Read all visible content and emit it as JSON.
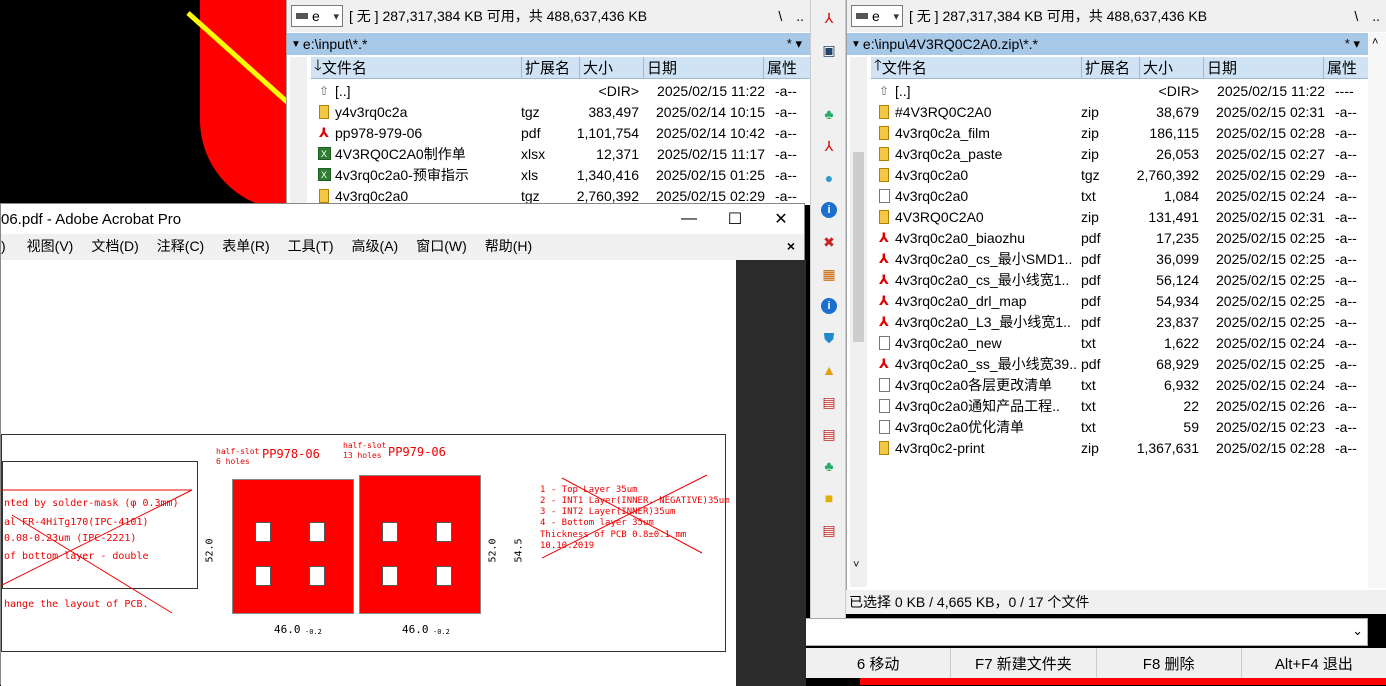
{
  "left_pane": {
    "drive_letter": "e",
    "drive_info": "[ 无 ]  287,317,384 KB 可用，共 488,637,436 KB",
    "path": "e:\\input\\*.*",
    "path_star": "*  ▾",
    "columns": [
      "文件名",
      "扩展名",
      "大小",
      "日期",
      "属性"
    ],
    "rows": [
      {
        "icon": "up",
        "name": "[..]",
        "ext": "",
        "size": "<DIR>",
        "date": "2025/02/15 11:22",
        "attr": "-a--"
      },
      {
        "icon": "zip",
        "name": "y4v3rq0c2a",
        "ext": "tgz",
        "size": "383,497",
        "date": "2025/02/14 10:15",
        "attr": "-a--"
      },
      {
        "icon": "pdf",
        "name": "pp978-979-06",
        "ext": "pdf",
        "size": "1,101,754",
        "date": "2025/02/14 10:42",
        "attr": "-a--"
      },
      {
        "icon": "xls",
        "name": "4V3RQ0C2A0制作单",
        "ext": "xlsx",
        "size": "12,371",
        "date": "2025/02/15 11:17",
        "attr": "-a--"
      },
      {
        "icon": "xls",
        "name": "4v3rq0c2a0-预审指示",
        "ext": "xls",
        "size": "1,340,416",
        "date": "2025/02/15 01:25",
        "attr": "-a--"
      },
      {
        "icon": "zip",
        "name": "4v3rq0c2a0",
        "ext": "tgz",
        "size": "2,760,392",
        "date": "2025/02/15 02:29",
        "attr": "-a--"
      }
    ]
  },
  "right_pane": {
    "drive_letter": "e",
    "drive_info": "[ 无 ]  287,317,384 KB 可用，共 488,637,436 KB",
    "path": "e:\\inpu\\4V3RQ0C2A0.zip\\*.*",
    "path_star": "*  ▾",
    "columns": [
      "文件名",
      "扩展名",
      "大小",
      "日期",
      "属性"
    ],
    "rows": [
      {
        "icon": "up",
        "name": "[..]",
        "ext": "",
        "size": "<DIR>",
        "date": "2025/02/15 11:22",
        "attr": "----"
      },
      {
        "icon": "zip",
        "name": "#4V3RQ0C2A0",
        "ext": "zip",
        "size": "38,679",
        "date": "2025/02/15 02:31",
        "attr": "-a--"
      },
      {
        "icon": "zip",
        "name": "4v3rq0c2a_film",
        "ext": "zip",
        "size": "186,115",
        "date": "2025/02/15 02:28",
        "attr": "-a--"
      },
      {
        "icon": "zip",
        "name": "4v3rq0c2a_paste",
        "ext": "zip",
        "size": "26,053",
        "date": "2025/02/15 02:27",
        "attr": "-a--"
      },
      {
        "icon": "zip",
        "name": "4v3rq0c2a0",
        "ext": "tgz",
        "size": "2,760,392",
        "date": "2025/02/15 02:29",
        "attr": "-a--"
      },
      {
        "icon": "txt",
        "name": "4v3rq0c2a0",
        "ext": "txt",
        "size": "1,084",
        "date": "2025/02/15 02:24",
        "attr": "-a--"
      },
      {
        "icon": "zip",
        "name": "4V3RQ0C2A0",
        "ext": "zip",
        "size": "131,491",
        "date": "2025/02/15 02:31",
        "attr": "-a--"
      },
      {
        "icon": "pdf",
        "name": "4v3rq0c2a0_biaozhu",
        "ext": "pdf",
        "size": "17,235",
        "date": "2025/02/15 02:25",
        "attr": "-a--"
      },
      {
        "icon": "pdf",
        "name": "4v3rq0c2a0_cs_最小SMD1..",
        "ext": "pdf",
        "size": "36,099",
        "date": "2025/02/15 02:25",
        "attr": "-a--"
      },
      {
        "icon": "pdf",
        "name": "4v3rq0c2a0_cs_最小线宽1..",
        "ext": "pdf",
        "size": "56,124",
        "date": "2025/02/15 02:25",
        "attr": "-a--"
      },
      {
        "icon": "pdf",
        "name": "4v3rq0c2a0_drl_map",
        "ext": "pdf",
        "size": "54,934",
        "date": "2025/02/15 02:25",
        "attr": "-a--"
      },
      {
        "icon": "pdf",
        "name": "4v3rq0c2a0_L3_最小线宽1..",
        "ext": "pdf",
        "size": "23,837",
        "date": "2025/02/15 02:25",
        "attr": "-a--"
      },
      {
        "icon": "txt",
        "name": "4v3rq0c2a0_new",
        "ext": "txt",
        "size": "1,622",
        "date": "2025/02/15 02:24",
        "attr": "-a--"
      },
      {
        "icon": "pdf",
        "name": "4v3rq0c2a0_ss_最小线宽39..",
        "ext": "pdf",
        "size": "68,929",
        "date": "2025/02/15 02:25",
        "attr": "-a--"
      },
      {
        "icon": "txt",
        "name": "4v3rq0c2a0各层更改清单",
        "ext": "txt",
        "size": "6,932",
        "date": "2025/02/15 02:24",
        "attr": "-a--"
      },
      {
        "icon": "txt",
        "name": "4v3rq0c2a0通知产品工程..",
        "ext": "txt",
        "size": "22",
        "date": "2025/02/15 02:26",
        "attr": "-a--"
      },
      {
        "icon": "txt",
        "name": "4v3rq0c2a0优化清单",
        "ext": "txt",
        "size": "59",
        "date": "2025/02/15 02:23",
        "attr": "-a--"
      },
      {
        "icon": "zip",
        "name": "4v3rq0c2-print",
        "ext": "zip",
        "size": "1,367,631",
        "date": "2025/02/15 02:28",
        "attr": "-a--"
      }
    ]
  },
  "status_text": "已选择 0 KB / 4,665 KB，0 / 17 个文件",
  "fkeys": [
    "6 移动",
    "F7 新建文件夹",
    "F8 删除",
    "Alt+F4 退出"
  ],
  "acrobat": {
    "title": "06.pdf - Adobe Acrobat Pro",
    "menu": [
      ")",
      "视图(V)",
      "文档(D)",
      "注释(C)",
      "表单(R)",
      "工具(T)",
      "高级(A)",
      "窗口(W)",
      "帮助(H)"
    ],
    "close_doc": "×",
    "drawing": {
      "left_notes": [
        "nted by solder-mask (φ 0.3mm)",
        "al   FR-4HiTg170(IPC-4101)",
        "0.08-0.23um (IPC-2221)",
        "of bottom layer - double"
      ],
      "left_bottom": "hange the layout of PCB.",
      "board1_label": "PP978-06",
      "board2_label": "PP979-06",
      "halfslot1": "half-slot",
      "halfslot1b": "6 holes",
      "halfslot2": "half-slot",
      "halfslot2b": "13 holes",
      "dim1": "46.0",
      "dim2": "46.0",
      "dim_sub": "-0.2",
      "dim_v1": "52.0",
      "dim_v2": "52.0",
      "dim_v3": "54.5",
      "layers": [
        "1 - Top Layer 35um",
        "2 - INT1 Layer(INNER, NEGATIVE)35um",
        "3 - INT2 Layer(INNER)35um",
        "4 - Bottom layer 35um",
        "Thickness of PCB 0.8±0.1 mm",
        "10.10.2019"
      ]
    }
  },
  "win_controls": {
    "min": "—",
    "max": "☐",
    "close": "✕"
  },
  "colors": {
    "path_bar": "#a8c8e8",
    "header": "#cfe3f5",
    "accent_red": "#ff0000"
  }
}
